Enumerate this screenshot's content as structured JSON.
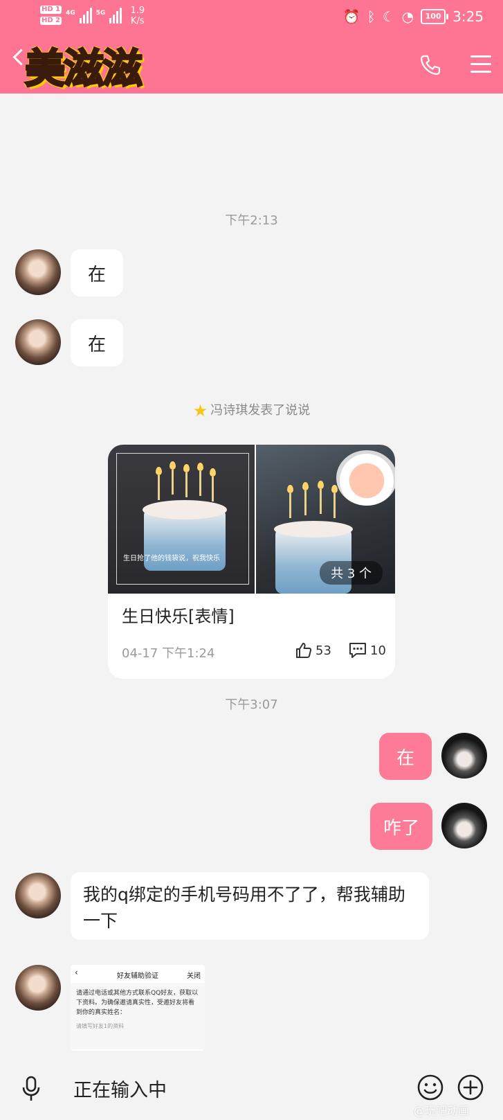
{
  "status_bar": {
    "sim1": "HD 1",
    "sim2": "HD 2",
    "net1": "4G",
    "net2": "5G",
    "speed_value": "1.9",
    "speed_unit": "K/s",
    "battery": "100",
    "time": "3:25"
  },
  "header": {
    "logo_text": "美滋滋",
    "accent_color": "#fe7593"
  },
  "messages": {
    "time1": "下午2:13",
    "msg1": "在",
    "msg2": "在",
    "notice": "冯诗琪发表了说说",
    "post": {
      "image_caption": "生日抢了他的钱袋说，祝我快乐",
      "count_badge": "共 3 个",
      "title": "生日快乐[表情]",
      "date": "04-17 下午1:24",
      "likes": "53",
      "comments": "10"
    },
    "time2": "下午3:07",
    "my_msg1": "在",
    "my_msg2": "咋了",
    "msg3": "我的q绑定的手机号码用不了了，帮我辅助一下",
    "screenshot": {
      "title": "好友辅助验证",
      "close": "关闭",
      "body": "请通过电话或其他方式联系QQ好友，获取以下资料。为确保邀请真实性，受邀好友将看到你的真实姓名：",
      "hint": "请填写好友1的资料"
    }
  },
  "input_bar": {
    "placeholder": "正在输入中"
  },
  "watermark": "@玩吧动画"
}
